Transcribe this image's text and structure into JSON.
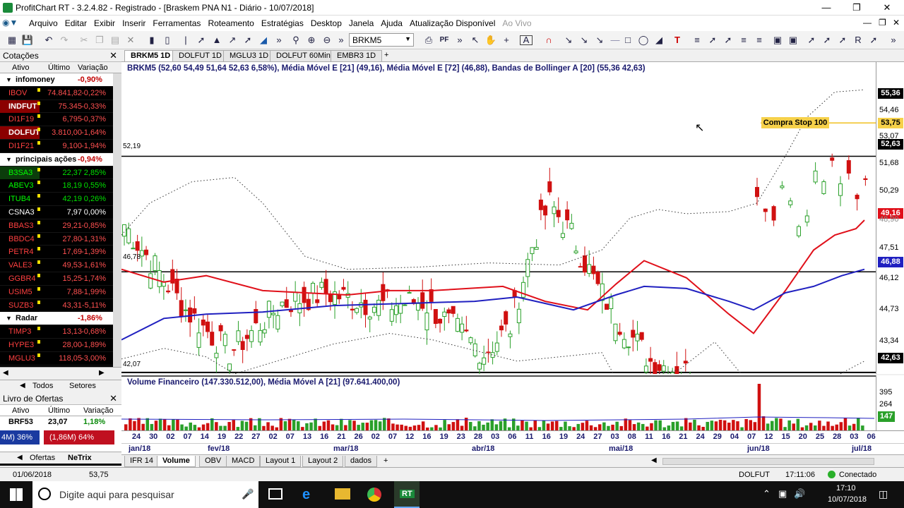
{
  "window": {
    "title": "ProfitChart RT - 3.2.4.82 - Registrado - [Braskem PNA N1 - Diário - 10/07/2018]"
  },
  "menu": [
    "Arquivo",
    "Editar",
    "Exibir",
    "Inserir",
    "Ferramentas",
    "Roteamento",
    "Estratégias",
    "Desktop",
    "Janela",
    "Ajuda",
    "Atualização Disponível",
    "Ao Vivo"
  ],
  "toolbar": {
    "symbol": "BRKM5"
  },
  "quotes": {
    "title": "Cotações",
    "cols": [
      "Ativo",
      "Último",
      "Variação"
    ],
    "rows": [
      {
        "grp": true,
        "name": "infomoney",
        "var": "-0,90%",
        "vc": "#c00000"
      },
      {
        "name": "IBOV",
        "last": "74.841,82",
        "var": "-0,22%",
        "nc": "#ff4040",
        "bg": "#000"
      },
      {
        "name": "INDFUT",
        "last": "75.345",
        "var": "-0,33%",
        "nc": "#fff",
        "bg": "#8b0000",
        "nb": true
      },
      {
        "name": "DI1F19",
        "last": "6,795",
        "var": "-0,37%",
        "nc": "#ff4040",
        "bg": "#000"
      },
      {
        "name": "DOLFUT",
        "last": "3.810,00",
        "var": "-1,64%",
        "nc": "#fff",
        "bg": "#8b0000",
        "nb": true
      },
      {
        "name": "DI1F21",
        "last": "9,100",
        "var": "-1,94%",
        "nc": "#ff4040",
        "bg": "#000"
      },
      {
        "grp": true,
        "name": "principais ações",
        "var": "-0,94%",
        "vc": "#c00000"
      },
      {
        "name": "B3SA3",
        "last": "22,37",
        "var": "2,85%",
        "nc": "#00ff00",
        "bg": "#0b3d0b",
        "up": true
      },
      {
        "name": "ABEV3",
        "last": "18,19",
        "var": "0,55%",
        "nc": "#00ff00",
        "bg": "#000",
        "up": true
      },
      {
        "name": "ITUB4",
        "last": "42,19",
        "var": "0,26%",
        "nc": "#00ff00",
        "bg": "#000",
        "up": true
      },
      {
        "name": "CSNA3",
        "last": "7,97",
        "var": "0,00%",
        "nc": "#fff",
        "bg": "#000",
        "wh": true
      },
      {
        "name": "BBAS3",
        "last": "29,21",
        "var": "-0,85%",
        "nc": "#ff4040",
        "bg": "#000"
      },
      {
        "name": "BBDC4",
        "last": "27,80",
        "var": "-1,31%",
        "nc": "#ff4040",
        "bg": "#000"
      },
      {
        "name": "PETR4",
        "last": "17,69",
        "var": "-1,39%",
        "nc": "#ff4040",
        "bg": "#000"
      },
      {
        "name": "VALE3",
        "last": "49,53",
        "var": "-1,61%",
        "nc": "#ff4040",
        "bg": "#000"
      },
      {
        "name": "GGBR4",
        "last": "15,25",
        "var": "-1,74%",
        "nc": "#ff4040",
        "bg": "#000"
      },
      {
        "name": "USIM5",
        "last": "7,88",
        "var": "-1,99%",
        "nc": "#ff4040",
        "bg": "#000"
      },
      {
        "name": "SUZB3",
        "last": "43,31",
        "var": "-5,11%",
        "nc": "#ff4040",
        "bg": "#000"
      },
      {
        "grp": true,
        "name": "Radar",
        "var": "-1,86%",
        "vc": "#c00000"
      },
      {
        "name": "TIMP3",
        "last": "13,13",
        "var": "-0,68%",
        "nc": "#ff4040",
        "bg": "#000"
      },
      {
        "name": "HYPE3",
        "last": "28,00",
        "var": "-1,89%",
        "nc": "#ff4040",
        "bg": "#000"
      },
      {
        "name": "MGLU3",
        "last": "118,05",
        "var": "-3,00%",
        "nc": "#ff4040",
        "bg": "#000"
      }
    ],
    "tabs": [
      "Todos",
      "Setores"
    ]
  },
  "book": {
    "title": "Livro de Ofertas",
    "cols": [
      "Ativo",
      "Último",
      "Variação"
    ],
    "asset": "BRF53",
    "last": "23,07",
    "var": "1,18%",
    "buy": "4M) 36%",
    "sell": "(1,86M) 64%",
    "tabs": [
      "Ofertas",
      "NeTrix"
    ]
  },
  "chart_tabs": [
    "BRKM5 1D",
    "DOLFUT 1D",
    "MGLU3 1D",
    "DOLFUT 60Min",
    "EMBR3 1D"
  ],
  "legend": {
    "main": "BRKM5 (52,60 54,49 51,64 52,63 6,58%), Média Móvel E [21] (49,16), Média Móvel E [72] (46,88), Bandas de Bollinger A [20] (55,36 42,63)",
    "volume": "Volume Financeiro (147.330.512,00), Média Móvel A [21] (97.641.400,00)"
  },
  "annotations": {
    "line1": "52,19",
    "line2": "46,78",
    "line3": "42,07",
    "stop": "Compra Stop 100"
  },
  "yaxis": {
    "labels": [
      "54,46",
      "53,07",
      "51,68",
      "50,29",
      "48,90",
      "47,51",
      "46,12",
      "44,73",
      "43,34"
    ],
    "boxes": {
      "bb_up": "55,36",
      "stop": "53,75",
      "last": "52,63",
      "ema21": "49,16",
      "ema72": "46,88",
      "bb_low": "42,63"
    },
    "vol_labels": [
      "395",
      "264",
      "147"
    ]
  },
  "xaxis": {
    "days": [
      "24",
      "30",
      "02",
      "07",
      "14",
      "19",
      "22",
      "27",
      "02",
      "07",
      "13",
      "16",
      "21",
      "26",
      "02",
      "07",
      "12",
      "16",
      "19",
      "23",
      "28",
      "03",
      "06",
      "11",
      "16",
      "19",
      "24",
      "27",
      "03",
      "08",
      "11",
      "16",
      "21",
      "24",
      "29",
      "04",
      "07",
      "12",
      "15",
      "20",
      "25",
      "28",
      "03",
      "06"
    ],
    "months": [
      "jan/18",
      "fev/18",
      "mar/18",
      "abr/18",
      "mai/18",
      "jun/18",
      "jul/18"
    ]
  },
  "bottom_tabs": [
    "IFR 14",
    "Volume",
    "OBV",
    "MACD",
    "Layout 1",
    "Layout 2",
    "dados"
  ],
  "status": {
    "date": "01/06/2018",
    "value": "53,75",
    "asset": "DOLFUT",
    "time": "17:11:06",
    "conn": "Conectado"
  },
  "taskbar": {
    "search": "Digite aqui para pesquisar",
    "time": "17:10",
    "date": "10/07/2018",
    "rt": "RT"
  },
  "colors": {
    "ema21": "#e0101a",
    "ema72": "#2020c0",
    "up": "#2aa02a",
    "down": "#d01010"
  }
}
